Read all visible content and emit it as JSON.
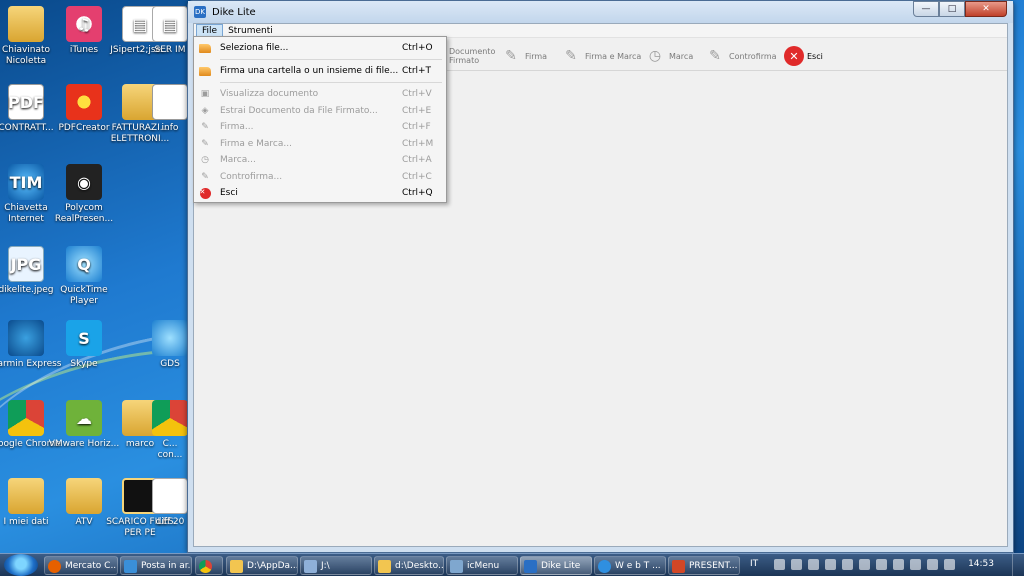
{
  "desktop": {
    "icons": [
      {
        "label": "Chiavinato Nicoletta",
        "icon": "folder-user-icon"
      },
      {
        "label": "iTunes",
        "icon": "itunes-icon"
      },
      {
        "label": "JSipert2;jse...",
        "icon": "document-icon"
      },
      {
        "label": "SER IM",
        "icon": "document-icon"
      },
      {
        "label": "CONTRATT...",
        "icon": "pdf-icon"
      },
      {
        "label": "PDFCreator",
        "icon": "pdfcreator-icon"
      },
      {
        "label": "FATTURAZI... ELETTRONI...",
        "icon": "folder-icon"
      },
      {
        "label": "info",
        "icon": "document-icon"
      },
      {
        "label": "Chiavetta Internet",
        "icon": "tim-icon"
      },
      {
        "label": "Polycom RealPresen...",
        "icon": "polycom-icon"
      },
      {
        "label": "dikelite.jpeg",
        "icon": "image-icon"
      },
      {
        "label": "QuickTime Player",
        "icon": "quicktime-icon"
      },
      {
        "label": "Garmin Express",
        "icon": "garmin-icon"
      },
      {
        "label": "Skype",
        "icon": "skype-icon"
      },
      {
        "label": "GDS",
        "icon": "app-icon"
      },
      {
        "label": "Google Chrome",
        "icon": "chrome-icon"
      },
      {
        "label": "VMware Horiz...",
        "icon": "vmware-icon"
      },
      {
        "label": "marco",
        "icon": "folder-icon"
      },
      {
        "label": "C... con...",
        "icon": "app-icon"
      },
      {
        "label": "I miei dati",
        "icon": "folder-user-icon"
      },
      {
        "label": "ATV",
        "icon": "folder-icon"
      },
      {
        "label": "SCARICO FILES PER PE",
        "icon": "folder-icon"
      },
      {
        "label": "diff 20",
        "icon": "app-icon"
      }
    ]
  },
  "window": {
    "title": "Dike Lite",
    "controls": {
      "minimize": "—",
      "maximize": "□",
      "close": "✕"
    }
  },
  "menubar": {
    "file": "File",
    "strumenti": "Strumenti"
  },
  "toolbar": {
    "items": [
      {
        "label": "Documento Firmato",
        "icon": "document-signed-icon"
      },
      {
        "label": "Firma",
        "icon": "pen-icon"
      },
      {
        "label": "Firma e Marca",
        "icon": "pen-stamp-icon"
      },
      {
        "label": "Marca",
        "icon": "clock-icon"
      },
      {
        "label": "Controfirma",
        "icon": "countersign-icon"
      },
      {
        "label": "Esci",
        "icon": "exit-icon"
      }
    ]
  },
  "file_menu": {
    "items": [
      {
        "label": "Seleziona file...",
        "shortcut": "Ctrl+O",
        "enabled": true,
        "icon": "folder-open-icon"
      },
      {
        "label": "Firma una cartella o un insieme di file...",
        "shortcut": "Ctrl+T",
        "enabled": true,
        "icon": "folder-open-icon"
      },
      {
        "label": "Visualizza documento",
        "shortcut": "Ctrl+V",
        "enabled": false,
        "icon": "view-document-icon"
      },
      {
        "label": "Estrai Documento  da File Firmato...",
        "shortcut": "Ctrl+E",
        "enabled": false,
        "icon": "extract-icon"
      },
      {
        "label": "Firma...",
        "shortcut": "Ctrl+F",
        "enabled": false,
        "icon": "pen-icon"
      },
      {
        "label": "Firma e Marca...",
        "shortcut": "Ctrl+M",
        "enabled": false,
        "icon": "pen-stamp-icon"
      },
      {
        "label": "Marca...",
        "shortcut": "Ctrl+A",
        "enabled": false,
        "icon": "clock-icon"
      },
      {
        "label": "Controfirma...",
        "shortcut": "Ctrl+C",
        "enabled": false,
        "icon": "countersign-icon"
      },
      {
        "label": "Esci",
        "shortcut": "Ctrl+Q",
        "enabled": true,
        "icon": "exit-icon"
      }
    ]
  },
  "taskbar": {
    "buttons": [
      {
        "label": "Mercato C...",
        "icon": "firefox-icon"
      },
      {
        "label": "Posta in ar...",
        "icon": "mail-icon"
      },
      {
        "label": "",
        "icon": "chrome-icon"
      },
      {
        "label": "D:\\AppDa...",
        "icon": "folder-icon"
      },
      {
        "label": "J:\\",
        "icon": "drive-icon"
      },
      {
        "label": "d:\\Deskto...",
        "icon": "folder-icon"
      },
      {
        "label": "icMenu",
        "icon": "app-icon"
      },
      {
        "label": "Dike Lite",
        "icon": "dike-icon"
      },
      {
        "label": "W e b T ...",
        "icon": "ie-icon"
      },
      {
        "label": "PRESENT...",
        "icon": "powerpoint-icon"
      }
    ],
    "language": "IT",
    "clock": "14:53"
  }
}
